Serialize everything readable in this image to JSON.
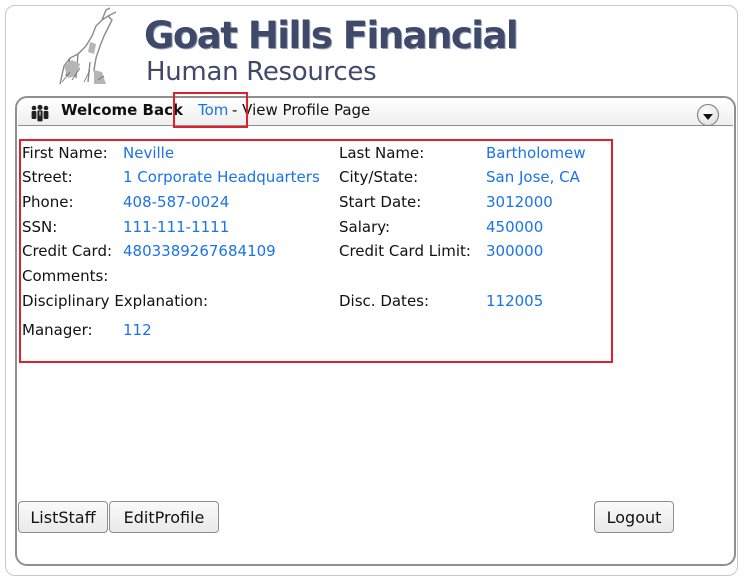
{
  "header": {
    "company_name": "Goat Hills Financial",
    "department": "Human Resources"
  },
  "welcome_bar": {
    "welcome_text": "Welcome Back",
    "user_name": "Tom",
    "page_suffix": "- View Profile Page"
  },
  "profile": {
    "first_name_label": "First Name:",
    "first_name": "Neville",
    "last_name_label": "Last Name:",
    "last_name": "Bartholomew",
    "street_label": "Street:",
    "street": "1 Corporate Headquarters",
    "city_state_label": "City/State:",
    "city_state": "San Jose, CA",
    "phone_label": "Phone:",
    "phone": "408-587-0024",
    "start_date_label": "Start Date:",
    "start_date": "3012000",
    "ssn_label": "SSN:",
    "ssn": "111-111-1111",
    "salary_label": "Salary:",
    "salary": "450000",
    "credit_card_label": "Credit Card:",
    "credit_card": "4803389267684109",
    "credit_limit_label": "Credit Card Limit:",
    "credit_limit": "300000",
    "comments_label": "Comments:",
    "disciplinary_label": "Disciplinary Explanation:",
    "disc_dates_label": "Disc. Dates:",
    "disc_dates": "112005",
    "manager_label": "Manager:",
    "manager": "112"
  },
  "buttons": {
    "list_staff": "ListStaff",
    "edit_profile": "EditProfile",
    "logout": "Logout"
  },
  "icons": {
    "logo": "goat-logo-icon",
    "header": "users-group-icon",
    "collapse": "chevron-down-icon"
  },
  "colors": {
    "link": "#1a73e8",
    "highlight": "#e0202a",
    "title": "#3f4a6a"
  }
}
